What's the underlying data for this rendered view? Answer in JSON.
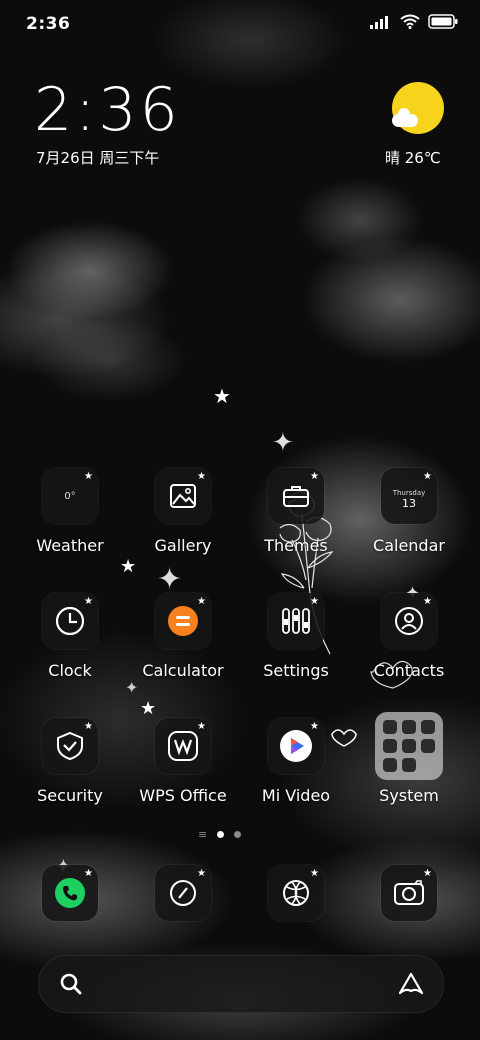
{
  "status_bar": {
    "time": "2:36"
  },
  "widget": {
    "clock": "2:36",
    "date": "7月26日 周三下午",
    "weather": "晴 26℃"
  },
  "apps": [
    {
      "label": "Weather",
      "icon": "weather-icon",
      "detail": "0°"
    },
    {
      "label": "Gallery",
      "icon": "gallery-icon"
    },
    {
      "label": "Themes",
      "icon": "themes-icon"
    },
    {
      "label": "Calendar",
      "icon": "calendar-icon",
      "detail_day": "Thursday",
      "detail_date": "13"
    },
    {
      "label": "Clock",
      "icon": "clock-icon"
    },
    {
      "label": "Calculator",
      "icon": "calculator-icon"
    },
    {
      "label": "Settings",
      "icon": "settings-icon"
    },
    {
      "label": "Contacts",
      "icon": "contacts-icon"
    },
    {
      "label": "Security",
      "icon": "security-icon"
    },
    {
      "label": "WPS Office",
      "icon": "wps-office-icon"
    },
    {
      "label": "Mi Video",
      "icon": "mi-video-icon"
    },
    {
      "label": "System",
      "icon": "system-folder"
    }
  ],
  "dock": [
    "phone-icon",
    "compass-icon",
    "browser-icon",
    "camera-icon"
  ],
  "colors": {
    "sun": "#f8d31c",
    "calculator": "#f7811e",
    "phone": "#1fcf62"
  }
}
